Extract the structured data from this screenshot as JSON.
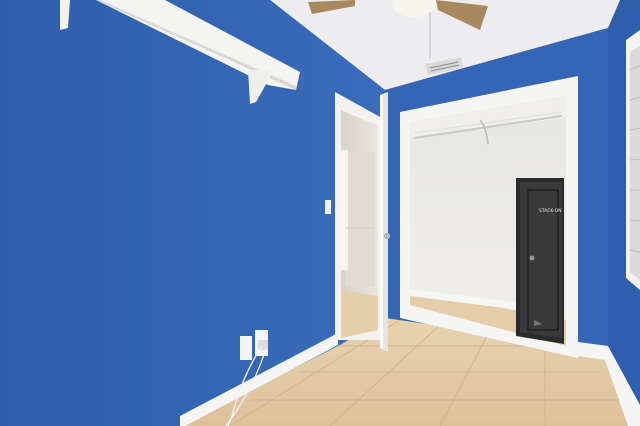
{
  "scene": {
    "colors": {
      "wall_blue": "#3566b5",
      "wall_blue_dark": "#2a529a",
      "ceiling": "#eeeef0",
      "trim_white": "#f4f4f2",
      "tile_beige": "#e2c9a3",
      "closet_wall": "#ecebe8",
      "safe_black": "#2b2b2c",
      "fan_blade": "#a8895f"
    },
    "safe_brand_text": "STACK-ON",
    "objects": {
      "shelf": "wall-shelf",
      "fan": "ceiling-fan",
      "vent": "ceiling-air-vent",
      "outlet": "electrical-outlet",
      "closet": "walk-in-closet",
      "safe": "gun-safe",
      "door": "open-door",
      "window": "window-blinds",
      "floor": "tile-floor"
    }
  }
}
